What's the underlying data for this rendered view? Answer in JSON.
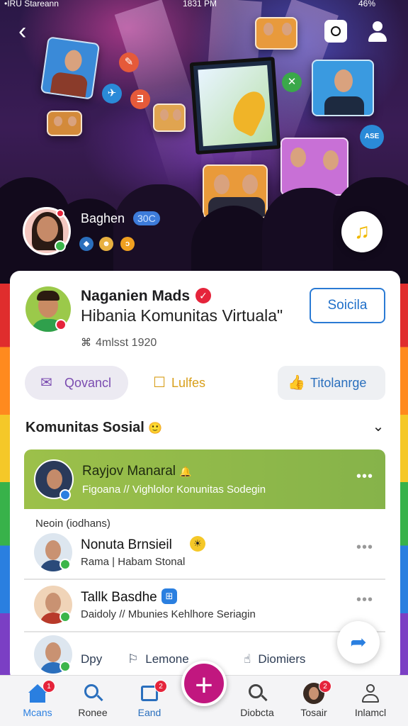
{
  "status_bar": {
    "carrier": "•IRU Stareann",
    "time": "1831 PM",
    "battery": "46%"
  },
  "header": {
    "back_icon": "back-arrow-icon",
    "camera_icon": "camera-icon",
    "profile_icon": "user-add-icon"
  },
  "hero": {
    "host_name": "Baghen",
    "host_badge": "30C",
    "music_icon": "music-note-icon"
  },
  "profile": {
    "name": "Naganien Mads",
    "subtitle": "Hibania Komunitas Virtuala\"",
    "meta": "4mlsst 1920",
    "action_button": "Soicila"
  },
  "actions": [
    {
      "label": "Qovancl",
      "icon": "mail-icon"
    },
    {
      "label": "Lulfes",
      "icon": "chat-icon"
    },
    {
      "label": "Titolanrge",
      "icon": "thumbs-up-icon"
    }
  ],
  "section": {
    "title": "Komunitas Sosial"
  },
  "featured": {
    "name": "Rayjov Manaral",
    "subtitle": "Figoana // Vighlolor Konunitas Sodegin"
  },
  "group_label": "Neoin (iodhans)",
  "members": [
    {
      "name": "Nonuta Brnsieil",
      "subtitle": "Rama | Habam Stonal"
    },
    {
      "name": "Tallk Basdhe",
      "subtitle": "Daidoly // Mbunies Kehlhore Seriagin"
    }
  ],
  "partial_row": {
    "label_1": "Dpy",
    "label_2": "Lemone",
    "label_3": "Diomiers"
  },
  "bottom_nav": [
    {
      "label": "Mcans",
      "badge": "1"
    },
    {
      "label": "Ronee"
    },
    {
      "label": "Eand",
      "badge": "2"
    },
    {
      "label": "Diobcta"
    },
    {
      "label": "Tosair",
      "badge": "2"
    },
    {
      "label": "Inlamcl"
    }
  ],
  "colors": {
    "accent_blue": "#2a7fe0",
    "fab_magenta": "#c1177f",
    "feature_green": "#9cc04a",
    "alert_red": "#e5243b"
  }
}
